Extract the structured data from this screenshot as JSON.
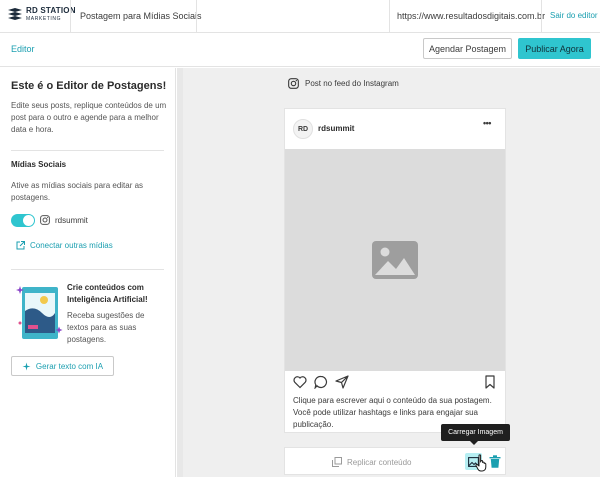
{
  "topbar": {
    "brand": "RD STATION",
    "brand_sub": "MARKETING",
    "title": "Postagem para Mídias Sociais",
    "url": "https://www.resultadosdigitais.com.br",
    "exit": "Sair do editor"
  },
  "subbar": {
    "breadcrumb": "Editor",
    "schedule_label": "Agendar Postagem",
    "publish_label": "Publicar Agora"
  },
  "sidebar": {
    "title": "Este é o Editor de Postagens!",
    "description": "Edite seus posts, replique conteúdos de um post para o outro e agende para a melhor data e hora.",
    "social_heading": "Mídias Sociais",
    "social_description": "Ative as mídias sociais para editar as postagens.",
    "account": {
      "name": "rdsummit",
      "enabled": true,
      "icon": "instagram-icon"
    },
    "connect_label": "Conectar outras mídias",
    "ai": {
      "title": "Crie conteúdos com Inteligência Artificial!",
      "description": "Receba sugestões de textos para as suas postagens.",
      "button_label": "Gerar texto com IA"
    }
  },
  "main": {
    "post_type": "Post no feed do Instagram",
    "card": {
      "avatar_initials": "RD",
      "username": "rdsummit",
      "more": "•••",
      "caption": "Clique para escrever aqui o conteúdo da sua postagem. Você pode utilizar hashtags e links para engajar sua publicação."
    },
    "footer": {
      "replicate_label": "Replicar conteúdo",
      "tooltip": "Carregar Imagem"
    }
  },
  "colors": {
    "accent": "#2fc5cf",
    "link": "#1b9fb0",
    "placeholder": "#dcdcdc"
  }
}
